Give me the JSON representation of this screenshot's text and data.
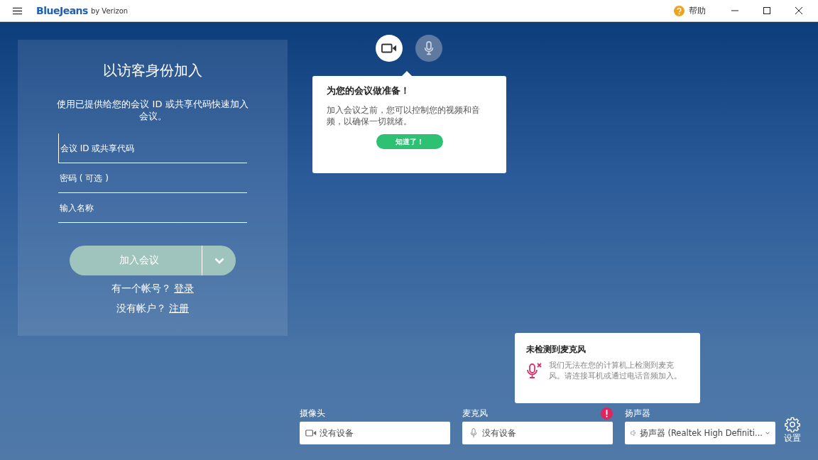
{
  "app": {
    "brand": "BlueJeans",
    "brand_suffix": "by Verizon",
    "help": "帮助"
  },
  "join_panel": {
    "title": "以访客身份加入",
    "description": "使用已提供给您的会议 ID 或共享代码快速加入会议。",
    "fields": [
      {
        "placeholder": "会议 ID 或共享代码",
        "focused": true
      },
      {
        "placeholder": "密码 ( 可选 )",
        "focused": false
      },
      {
        "placeholder": "输入名称",
        "focused": false
      }
    ],
    "join_button": {
      "label": "加入会议",
      "disabled": true
    },
    "links": [
      {
        "text": "有一个帐号？",
        "link": "登录"
      },
      {
        "text": "没有帐户？",
        "link": "注册"
      }
    ]
  },
  "media_toggles": [
    {
      "kind": "camera",
      "on": true
    },
    {
      "kind": "mic",
      "on": false
    }
  ],
  "tooltip": {
    "title": "为您的会议做准备！",
    "body": "加入会议之前，您可以控制您的视频和音频，以确保一切就绪。",
    "button": "知道了！"
  },
  "mic_warning": {
    "title": "未检测到麦克风",
    "body": "我们无法在您的计算机上检测到麦克风。请连接耳机或通过电话音频加入。"
  },
  "devices": [
    {
      "kind": "camera",
      "label": "摄像头",
      "value": "没有设备",
      "warning": false,
      "dropdown": false
    },
    {
      "kind": "mic",
      "label": "麦克风",
      "value": "没有设备",
      "warning": true,
      "dropdown": false
    },
    {
      "kind": "speaker",
      "label": "扬声器",
      "value": "扬声器 (Realtek High Definiti...",
      "warning": false,
      "dropdown": true
    }
  ],
  "settings": {
    "label": "设置"
  }
}
